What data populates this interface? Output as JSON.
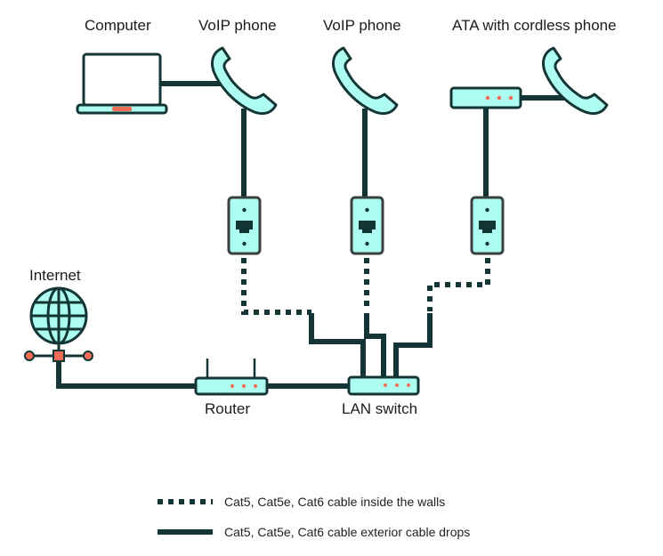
{
  "diagram": {
    "labels": {
      "computer": "Computer",
      "voip_phone_1": "VoIP phone",
      "voip_phone_2": "VoIP phone",
      "ata": "ATA with cordless phone",
      "internet": "Internet",
      "router": "Router",
      "lan_switch": "LAN switch"
    },
    "legend": [
      {
        "style": "dotted",
        "label": "Cat5, Cat5e, Cat6 cable inside the walls"
      },
      {
        "style": "solid",
        "label": "Cat5, Cat5e, Cat6 cable exterior cable drops"
      }
    ],
    "colors": {
      "stroke": "#133535",
      "fill": "#adfdf0",
      "led": "#f26b54",
      "wallplate_border": "#3a3f40"
    }
  }
}
